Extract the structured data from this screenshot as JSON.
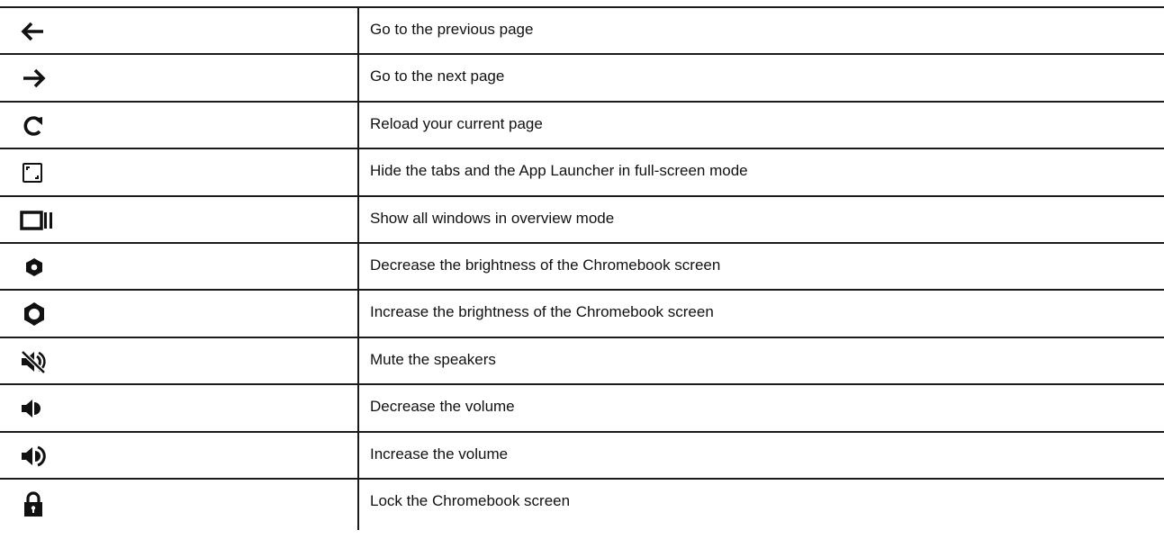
{
  "rows": [
    {
      "icon": "back-arrow-icon",
      "description": "Go to the previous page"
    },
    {
      "icon": "forward-arrow-icon",
      "description": "Go to the next page"
    },
    {
      "icon": "refresh-icon",
      "description": "Reload your current page"
    },
    {
      "icon": "full-screen-icon",
      "description": "Hide the tabs and the App Launcher in full-screen mode"
    },
    {
      "icon": "overview-mode-icon",
      "description": "Show all windows in overview mode"
    },
    {
      "icon": "brightness-down-icon",
      "description": "Decrease the brightness of the Chromebook screen"
    },
    {
      "icon": "brightness-up-icon",
      "description": "Increase the brightness of the Chromebook screen"
    },
    {
      "icon": "mute-icon",
      "description": "Mute the speakers"
    },
    {
      "icon": "volume-down-icon",
      "description": "Decrease the volume"
    },
    {
      "icon": "volume-up-icon",
      "description": "Increase the volume"
    },
    {
      "icon": "lock-icon",
      "description": "Lock the Chromebook screen"
    }
  ]
}
